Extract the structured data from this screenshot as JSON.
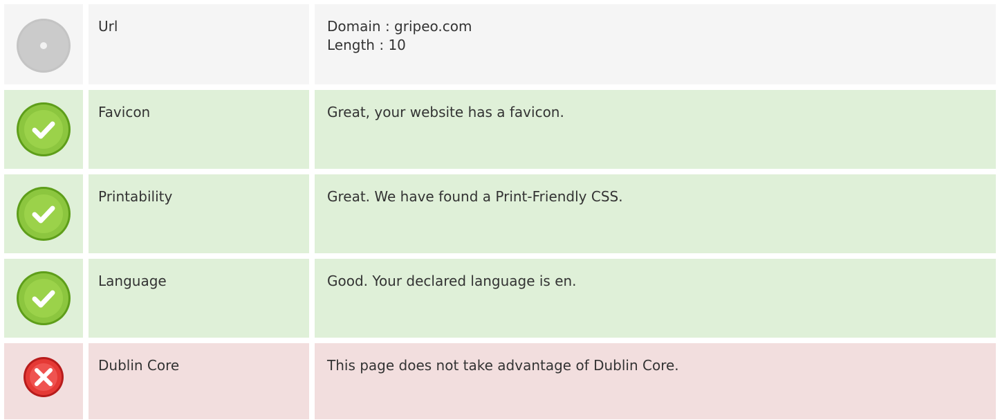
{
  "rows": [
    {
      "status": "neutral",
      "icon": "neutral-dot-icon",
      "label": "Url",
      "lines": [
        "Domain : gripeo.com",
        "Length : 10"
      ]
    },
    {
      "status": "pass",
      "icon": "check-icon",
      "label": "Favicon",
      "lines": [
        "Great, your website has a favicon."
      ]
    },
    {
      "status": "pass",
      "icon": "check-icon",
      "label": "Printability",
      "lines": [
        "Great. We have found a Print-Friendly CSS."
      ]
    },
    {
      "status": "pass",
      "icon": "check-icon",
      "label": "Language",
      "lines": [
        "Good. Your declared language is en."
      ]
    },
    {
      "status": "fail",
      "icon": "cross-icon",
      "label": "Dublin Core",
      "lines": [
        "This page does not take advantage of Dublin Core."
      ]
    }
  ],
  "colors": {
    "neutral_bg": "#f5f5f5",
    "pass_bg": "#dff0d8",
    "fail_bg": "#f2dede",
    "check_green": "#8cc63f",
    "cross_red": "#e53935",
    "neutral_grey": "#c4c4c4"
  }
}
